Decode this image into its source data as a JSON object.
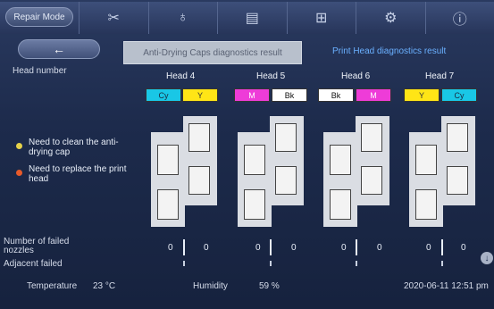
{
  "toolbar": {
    "repair_mode_label": "Repair Mode"
  },
  "nav": {
    "back_arrow": "←",
    "tab_active": "Anti-Drying Caps diagnostics result",
    "tab_link": "Print Head diagnostics result"
  },
  "head_number_label": "Head number",
  "heads": [
    {
      "name": "Head 4",
      "chips": [
        {
          "label": "Cy",
          "bg": "#19c7e6"
        },
        {
          "label": "Y",
          "bg": "#ffe516"
        }
      ],
      "failed_left": "0",
      "failed_right": "0"
    },
    {
      "name": "Head 5",
      "chips": [
        {
          "label": "M",
          "bg": "#ee3cd8"
        },
        {
          "label": "Bk",
          "bg": "#ffffff"
        }
      ],
      "failed_left": "0",
      "failed_right": "0"
    },
    {
      "name": "Head 6",
      "chips": [
        {
          "label": "Bk",
          "bg": "#ffffff"
        },
        {
          "label": "M",
          "bg": "#ee3cd8"
        }
      ],
      "failed_left": "0",
      "failed_right": "0"
    },
    {
      "name": "Head 7",
      "chips": [
        {
          "label": "Y",
          "bg": "#ffe516"
        },
        {
          "label": "Cy",
          "bg": "#19c7e6"
        }
      ],
      "failed_left": "0",
      "failed_right": "0"
    }
  ],
  "legend": {
    "clean_cap": "Need to clean the anti-drying cap",
    "clean_cap_color": "#e6d24a",
    "replace_head": "Need to replace the print head",
    "replace_head_color": "#e85a2a"
  },
  "rows": {
    "failed_nozzles": "Number of failed nozzles",
    "adjacent_failed": "Adjacent failed"
  },
  "footer": {
    "temperature_label": "Temperature",
    "temperature_value": "23 °C",
    "humidity_label": "Humidity",
    "humidity_value": "59 %",
    "datetime": "2020-06-11 12:51 pm"
  }
}
